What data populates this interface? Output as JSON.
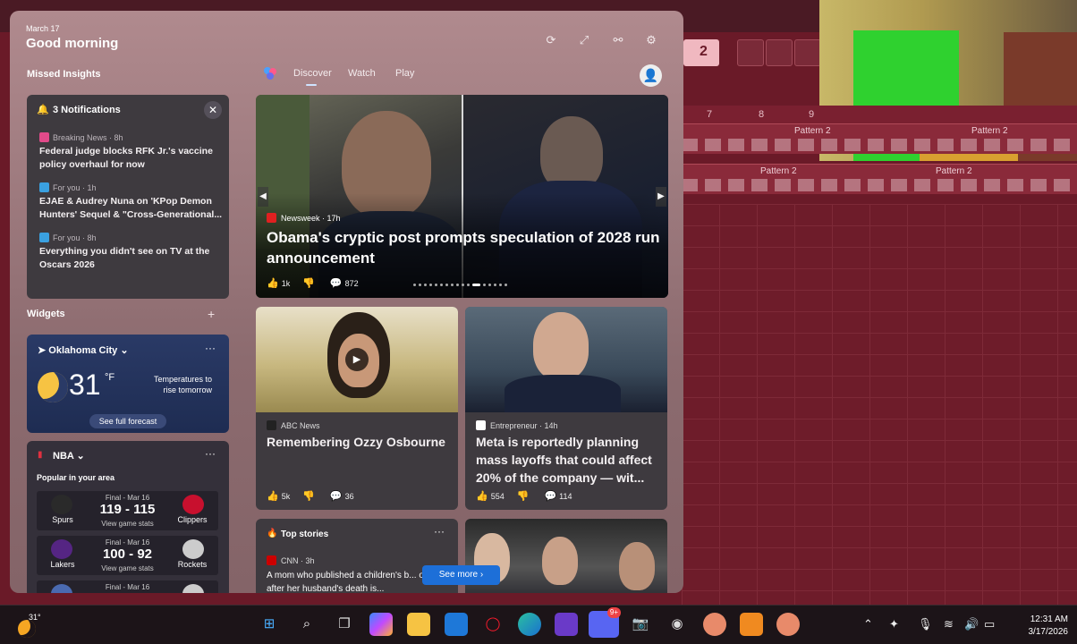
{
  "panel": {
    "date": "March 17",
    "greeting": "Good morning",
    "header_icons": [
      "refresh-icon",
      "expand-icon",
      "link-icon",
      "settings-icon"
    ]
  },
  "missed_insights": {
    "title": "Missed Insights",
    "notifications": {
      "title": "3 Notifications",
      "items": [
        {
          "source": "Breaking News · 8h",
          "text": "Federal judge blocks RFK Jr.'s vaccine policy overhaul for now"
        },
        {
          "source": "For you · 1h",
          "text": "EJAE & Audrey Nuna on 'KPop Demon Hunters' Sequel & \"Cross-Generational..."
        },
        {
          "source": "For you · 8h",
          "text": "Everything you didn't see on TV at the Oscars 2026"
        }
      ]
    }
  },
  "widgets": {
    "title": "Widgets",
    "weather": {
      "city": "Oklahoma City",
      "temp": "31",
      "unit": "°F",
      "note": "Temperatures to rise tomorrow",
      "forecast_button": "See full forecast"
    },
    "nba": {
      "title": "NBA",
      "subtitle": "Popular in your area",
      "games": [
        {
          "status": "Final - Mar 16",
          "score": "119 - 115",
          "link": "View game stats",
          "home": "Spurs",
          "away": "Clippers",
          "home_color": "#2a2a2a",
          "away_color": "#c8102e"
        },
        {
          "status": "Final - Mar 16",
          "score": "100 - 92",
          "link": "View game stats",
          "home": "Lakers",
          "away": "Rockets",
          "home_color": "#552583",
          "away_color": "#cccccc"
        },
        {
          "status": "Final - Mar 16",
          "score": "",
          "link": "",
          "home": "",
          "away": "",
          "home_color": "#4a6ab0",
          "away_color": "#cccccc"
        }
      ]
    }
  },
  "feed": {
    "tabs": [
      "Discover",
      "Watch",
      "Play"
    ],
    "hero": {
      "source": "Newsweek · 17h",
      "title": "Obama's cryptic post prompts speculation of 2028 run announcement",
      "likes": "1k",
      "comments": "872"
    },
    "articles": [
      {
        "source": "ABC News",
        "title": "Remembering Ozzy Osbourne",
        "likes": "5k",
        "comments": "36"
      },
      {
        "source": "Entrepreneur · 14h",
        "title": "Meta is reportedly planning mass layoffs that could affect 20% of the company — wit...",
        "likes": "554",
        "comments": "114"
      }
    ],
    "top_stories": {
      "title": "Top stories",
      "source": "CNN · 3h",
      "text": "A mom who published a children's b... on grief after her husband's death is..."
    },
    "see_more": "See more"
  },
  "daw": {
    "ruler": [
      "7",
      "8",
      "9"
    ],
    "patterns": [
      "Pattern 2",
      "Pattern 2",
      "Pattern 2",
      "Pattern 2"
    ],
    "tool_number": "2"
  },
  "taskbar": {
    "weather_temp": "31°",
    "time": "12:31 AM",
    "date": "3/17/2026",
    "apps": [
      "start-icon",
      "search-icon",
      "task-view-icon",
      "copilot-icon",
      "file-explorer-icon",
      "outlook-icon",
      "opera-icon",
      "edge-icon",
      "clipchamp-icon",
      "discord-icon",
      "camera-icon",
      "obs-icon",
      "app-icon",
      "fl-studio-icon",
      "app-icon"
    ],
    "discord_badge": "9+"
  }
}
